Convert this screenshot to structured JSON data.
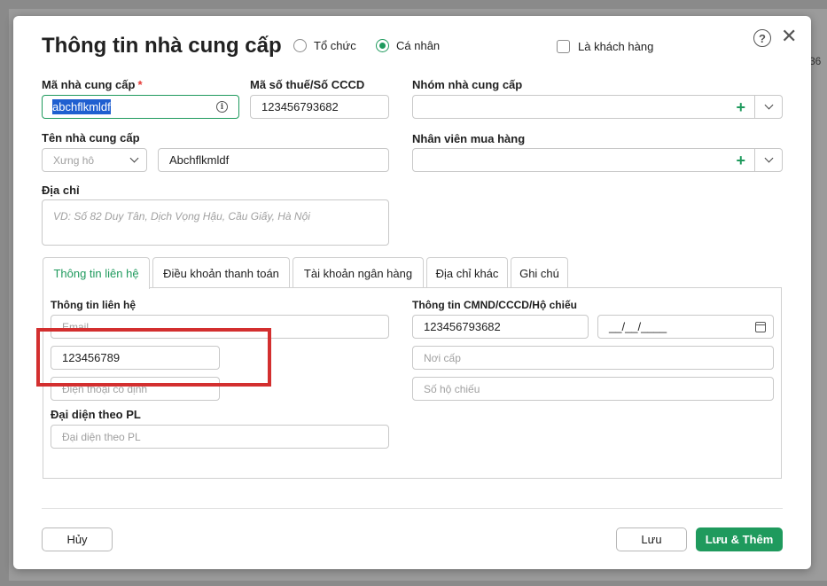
{
  "background": {
    "peek_text": "36"
  },
  "dialog": {
    "title": "Thông tin nhà cung cấp",
    "type_options": [
      {
        "label": "Tổ chức",
        "selected": false
      },
      {
        "label": "Cá nhân",
        "selected": true
      }
    ],
    "is_customer": {
      "label": "Là khách hàng",
      "checked": false
    }
  },
  "fields": {
    "supplier_code": {
      "label": "Mã nhà cung cấp",
      "value": "abchflkmldf"
    },
    "tax_id": {
      "label": "Mã số thuế/Số CCCD",
      "value": "123456793682"
    },
    "supplier_group": {
      "label": "Nhóm nhà cung cấp",
      "value": ""
    },
    "supplier_name": {
      "label": "Tên nhà cung cấp",
      "salutation_placeholder": "Xưng hô",
      "value": "Abchflkmldf"
    },
    "purchasing_staff": {
      "label": "Nhân viên mua hàng",
      "value": ""
    },
    "address": {
      "label": "Địa chỉ",
      "placeholder": "VD: Số 82 Duy Tân, Dịch Vọng Hậu, Cầu Giấy, Hà Nội"
    }
  },
  "tabs": [
    {
      "label": "Thông tin liên hệ",
      "active": true
    },
    {
      "label": "Điều khoản thanh toán",
      "active": false
    },
    {
      "label": "Tài khoản ngân hàng",
      "active": false
    },
    {
      "label": "Địa chỉ khác",
      "active": false
    },
    {
      "label": "Ghi chú",
      "active": false
    }
  ],
  "contact": {
    "section_label": "Thông tin liên hệ",
    "email_placeholder": "Email",
    "mobile_value": "123456789",
    "landline_placeholder": "Điện thoại cố định",
    "legal_rep_label": "Đại diện theo PL",
    "legal_rep_placeholder": "Đại diện theo PL"
  },
  "id_info": {
    "section_label": "Thông tin CMND/CCCD/Hộ chiếu",
    "id_number": "123456793682",
    "date_mask": "__/__/____",
    "issue_place_placeholder": "Nơi cấp",
    "passport_placeholder": "Số hộ chiếu"
  },
  "footer": {
    "cancel_label": "Hủy",
    "save_label": "Lưu",
    "save_add_label": "Lưu & Thêm"
  },
  "colors": {
    "accent": "#1f9a5d",
    "highlight": "#d32f2f",
    "selection": "#1f5fd0"
  }
}
